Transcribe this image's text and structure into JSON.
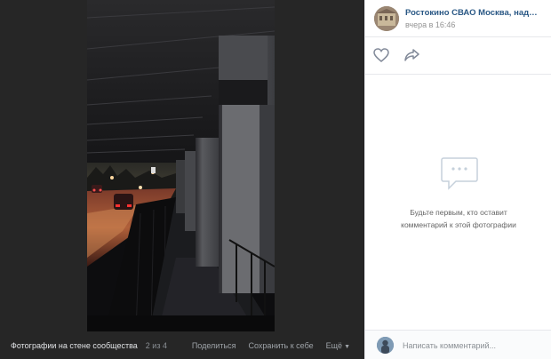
{
  "photo_viewer": {
    "album_title": "Фотографии на стене сообщества",
    "counter": "2 из 4",
    "actions": {
      "share": "Поделиться",
      "save": "Сохранить к себе",
      "more": "Ещё"
    }
  },
  "side_panel": {
    "author": {
      "name": "Ростокино СВАО Москва, надень",
      "time": "вчера в 16:46"
    },
    "icons": {
      "like": "heart-icon",
      "share": "share-arrow-icon",
      "empty": "comments-bubble-icon",
      "more": "chevron-down-icon"
    },
    "empty_state": {
      "line1": "Будьте первым, кто оставит",
      "line2": "комментарий к этой фотографии"
    },
    "comment": {
      "placeholder": "Написать комментарий..."
    }
  },
  "colors": {
    "viewer_bg": "#262626",
    "link": "#2a5885",
    "icon": "#828a99",
    "empty_icon": "#c5d0db"
  }
}
